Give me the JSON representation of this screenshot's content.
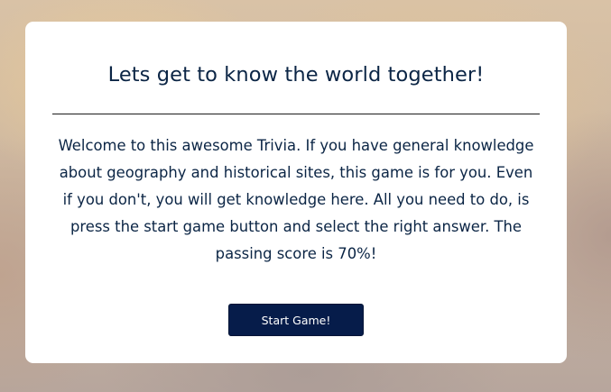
{
  "card": {
    "title": "Lets get to know the world together!",
    "intro": "Welcome to this awesome Trivia. If you have general knowledge about geography and historical sites, this game is for you. Even if you don't, you will get knowledge here. All you need to do, is press the start game button and select the right answer. The passing score is 70%!",
    "start_button_label": "Start Game!"
  },
  "colors": {
    "text": "#0b2545",
    "button_bg": "#061c4a",
    "button_text": "#ffffff",
    "card_bg": "#ffffff"
  }
}
